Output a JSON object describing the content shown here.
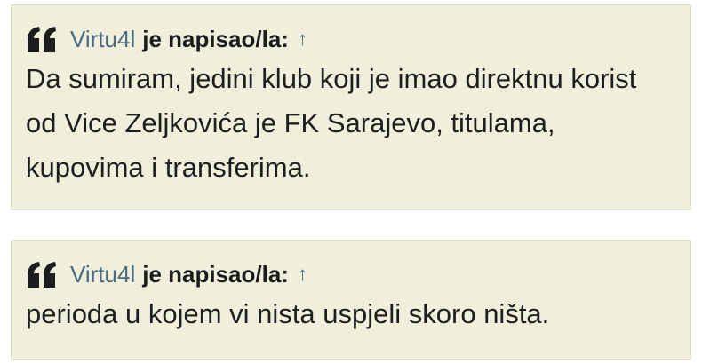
{
  "quotes": [
    {
      "author": "Virtu4l",
      "wrote_label": "je napisao/la:",
      "jump_icon": "↑",
      "text": "Da sumiram, jedini klub koji je imao direktnu korist od Vice Zeljkovića je FK Sarajevo, titulama, kupovima i transferima."
    },
    {
      "author": "Virtu4l",
      "wrote_label": "je napisao/la:",
      "jump_icon": "↑",
      "text": "perioda u kojem vi nista uspjeli skoro ništa."
    }
  ],
  "colors": {
    "quote_bg": "#efefdc",
    "author": "#4a6a80",
    "text": "#1e1e1e"
  },
  "icons": {
    "quote": "quote-icon",
    "jump": "arrow-up-icon"
  }
}
